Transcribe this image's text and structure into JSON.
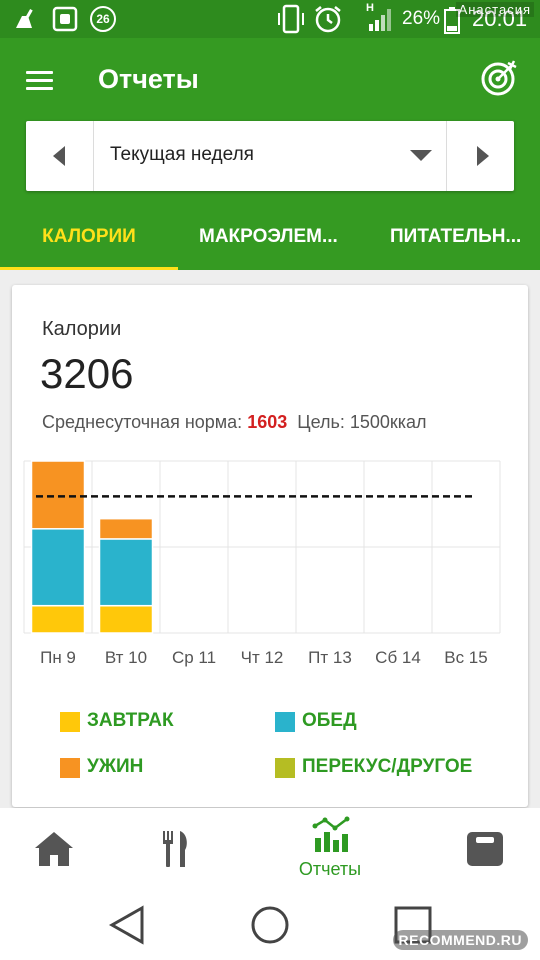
{
  "status_bar": {
    "notification_badge": "26",
    "battery_percent": "26",
    "time": "20:01",
    "network_type": "H",
    "watermark_user": "Анастасия"
  },
  "app": {
    "title": "Отчеты"
  },
  "period": {
    "label": "Текущая неделя"
  },
  "tabs": [
    {
      "label": "КАЛОРИИ",
      "active": true
    },
    {
      "label": "МАКРОЭЛЕМ..."
    },
    {
      "label": "ПИТАТЕЛЬН..."
    }
  ],
  "card": {
    "title": "Калории",
    "total": "3206",
    "avg_label": "Среднесуточная норма:",
    "avg_value": "1603",
    "goal_label": "Цель: 1500ккал"
  },
  "chart_data": {
    "type": "bar",
    "stacked": true,
    "categories": [
      "Пн 9",
      "Вт 10",
      "Ср 11",
      "Чт 12",
      "Пт 13",
      "Сб 14",
      "Вс 15"
    ],
    "series": [
      {
        "name": "ЗАВТРАК",
        "color": "#ffc80a",
        "values": [
          270,
          270,
          0,
          0,
          0,
          0,
          0
        ]
      },
      {
        "name": "ОБЕД",
        "color": "#2ab3cc",
        "values": [
          760,
          660,
          0,
          0,
          0,
          0,
          0
        ]
      },
      {
        "name": "УЖИН",
        "color": "#f79322",
        "values": [
          670,
          200,
          0,
          0,
          0,
          0,
          0
        ]
      },
      {
        "name": "ПЕРЕКУС/ДРУГОЕ",
        "color": "#b5bd23",
        "values": [
          0,
          0,
          0,
          0,
          0,
          0,
          0
        ]
      }
    ],
    "goal_line": 1350,
    "ylim": [
      0,
      1700
    ],
    "grid": true
  },
  "legend": [
    {
      "label": "ЗАВТРАК",
      "color": "#ffc80a"
    },
    {
      "label": "ОБЕД",
      "color": "#2ab3cc"
    },
    {
      "label": "УЖИН",
      "color": "#f79322"
    },
    {
      "label": "ПЕРЕКУС/ДРУГОЕ",
      "color": "#b5bd23"
    }
  ],
  "bottom_nav": {
    "reports_label": "Отчеты"
  },
  "watermark": "RECOMMEND.RU"
}
